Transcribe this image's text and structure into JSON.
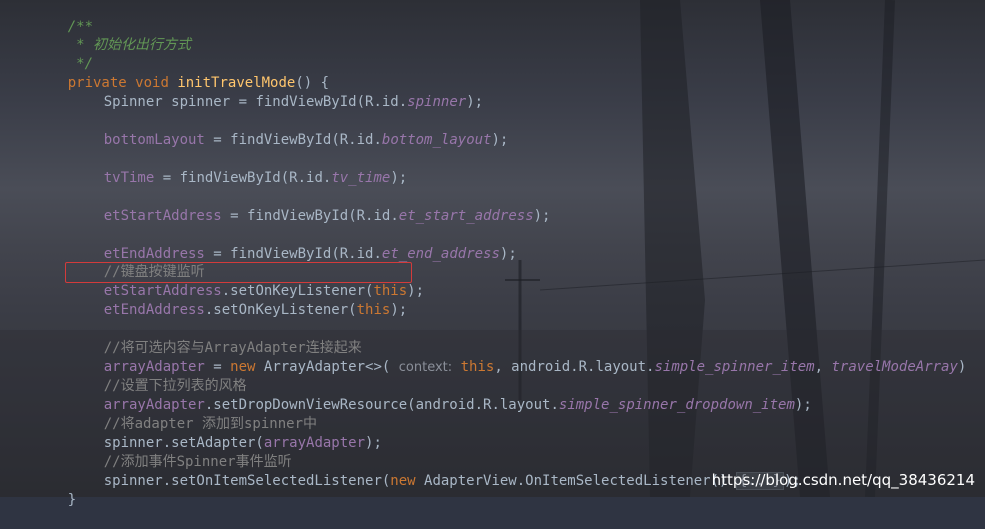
{
  "code": {
    "doc_open": "/**",
    "doc_text": " * 初始化出行方式",
    "doc_close": " */",
    "method_private": "private",
    "method_void": "void",
    "method_name": "initTravelMode",
    "method_params": "() {",
    "l_spinner_type": "Spinner spinner = ",
    "l_spinner_call": "findViewById",
    "l_spinner_arg_open": "(R.id.",
    "l_spinner_id": "spinner",
    "l_spinner_close": ");",
    "l_bottom_field": "bottomLayout",
    "l_bottom_eq": " = ",
    "l_bottom_call": "findViewById",
    "l_bottom_arg_open": "(R.id.",
    "l_bottom_id": "bottom_layout",
    "l_bottom_close": ");",
    "l_tvtime_field": "tvTime",
    "l_tvtime_eq": " = ",
    "l_tvtime_call": "findViewById",
    "l_tvtime_arg_open": "(R.id.",
    "l_tvtime_id": "tv_time",
    "l_tvtime_close": ");",
    "l_start_field": "etStartAddress",
    "l_start_eq": " = ",
    "l_start_call": "findViewById",
    "l_start_arg_open": "(R.id.",
    "l_start_id": "et_start_address",
    "l_start_close": ");",
    "l_end_field": "etEndAddress",
    "l_end_eq": " = ",
    "l_end_call": "findViewById",
    "l_end_arg_open": "(R.id.",
    "l_end_id": "et_end_address",
    "l_end_close": ");",
    "cm_keyboard": "//键盘按键监听",
    "l_startkey_field": "etStartAddress",
    "l_startkey_call": ".setOnKeyListener(",
    "l_startkey_this": "this",
    "l_startkey_close": ");",
    "l_endkey_field": "etEndAddress",
    "l_endkey_call": ".setOnKeyListener(",
    "l_endkey_this": "this",
    "l_endkey_close": ");",
    "cm_connect": "//将可选内容与ArrayAdapter连接起来",
    "l_adapter_field": "arrayAdapter",
    "l_adapter_eq": " = ",
    "l_adapter_new": "new",
    "l_adapter_type": " ArrayAdapter<>( ",
    "l_adapter_hint": "context:",
    "l_adapter_this": " this",
    "l_adapter_mid": ", android.R.layout.",
    "l_adapter_item": "simple_spinner_item",
    "l_adapter_comma": ", ",
    "l_adapter_array": "travelModeArray",
    "l_adapter_end": ")",
    "cm_style": "//设置下拉列表的风格",
    "l_dropdown_field": "arrayAdapter",
    "l_dropdown_call": ".setDropDownViewResource(android.R.layout.",
    "l_dropdown_res": "simple_spinner_dropdown_item",
    "l_dropdown_close": ");",
    "cm_add": "//将adapter 添加到spinner中",
    "l_setadapter_pre": "spinner.setAdapter(",
    "l_setadapter_field": "arrayAdapter",
    "l_setadapter_close": ");",
    "cm_event": "//添加事件Spinner事件监听",
    "l_listener_pre": "spinner.setOnItemSelectedListener(",
    "l_listener_new": "new",
    "l_listener_type": " AdapterView.OnItemSelectedListener() ",
    "l_listener_fold": "{...}",
    "l_listener_close": ");",
    "close_brace": "}"
  },
  "watermark": "https://blog.csdn.net/qq_38436214",
  "colors": {
    "keyword": "#cc7832",
    "method": "#ffc66d",
    "field": "#9876aa",
    "doc_comment": "#629755",
    "line_comment": "#808080",
    "plain": "#a9b7c6",
    "highlight_border": "#d33b3b"
  }
}
